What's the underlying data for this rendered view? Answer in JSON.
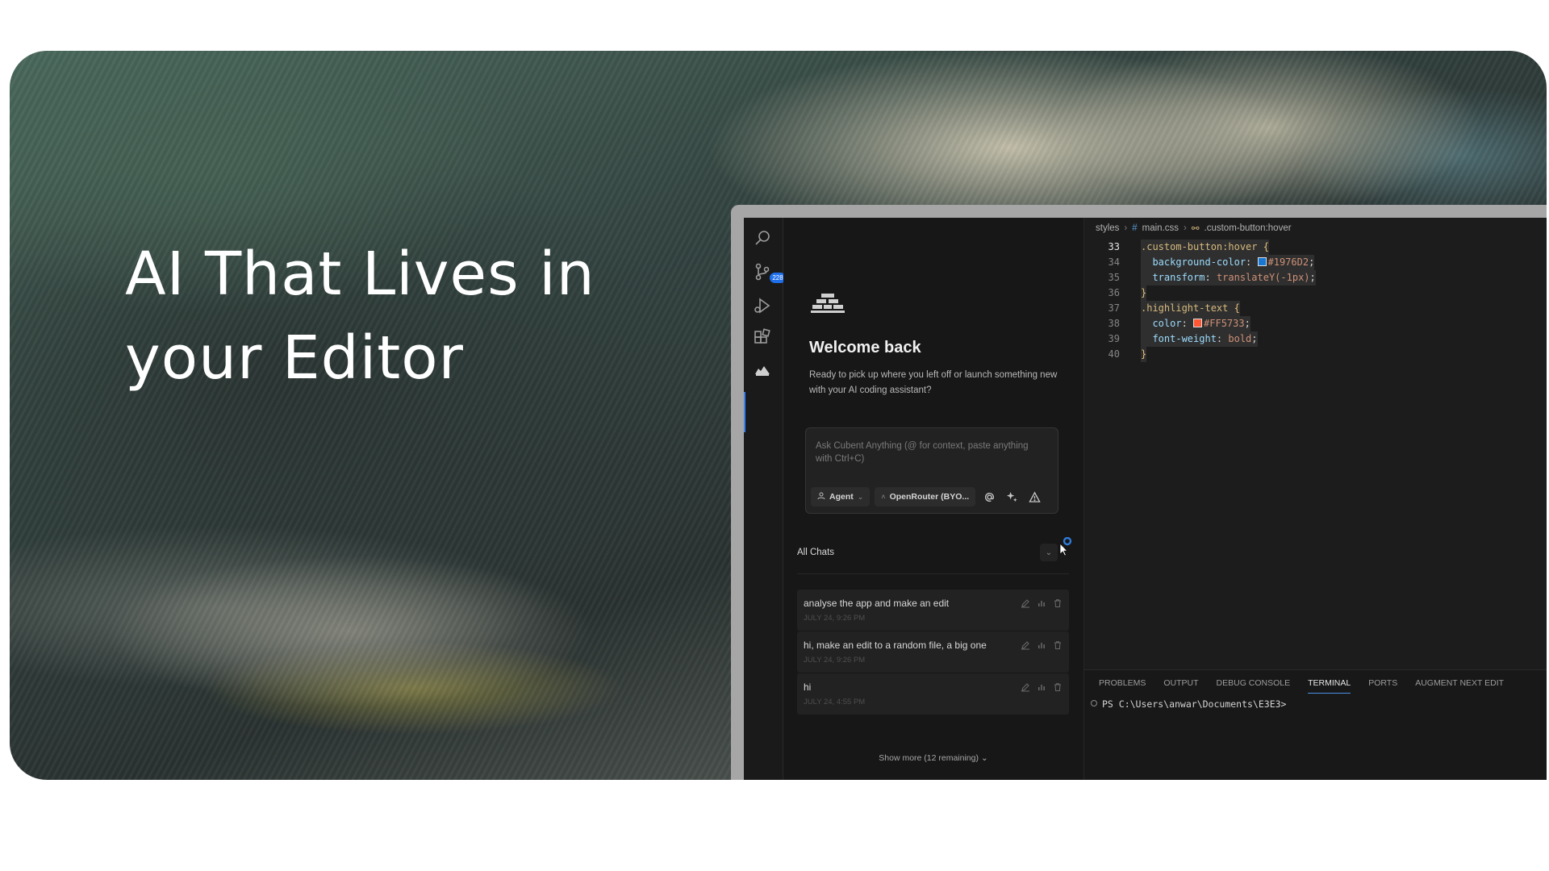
{
  "hero": {
    "headline_line1": "AI That Lives in",
    "headline_line2": "your Editor"
  },
  "activity_bar": {
    "icons": [
      "search-icon",
      "source-control-icon",
      "run-debug-icon",
      "extensions-icon",
      "cubent-icon"
    ],
    "source_control_badge": "228"
  },
  "chat_panel": {
    "welcome_title": "Welcome back",
    "welcome_subtitle": "Ready to pick up where you left off or launch something new with your AI coding assistant?",
    "input_placeholder": "Ask Cubent Anything (@ for context, paste anything with Ctrl+C)",
    "mode_label": "Agent",
    "model_label": "OpenRouter (BYO...",
    "all_chats_label": "All Chats",
    "chats": [
      {
        "title": "analyse the app and make an edit",
        "time": "JULY 24, 9:26 PM"
      },
      {
        "title": "hi, make an edit to a random file, a big one",
        "time": "JULY 24, 9:26 PM"
      },
      {
        "title": "hi",
        "time": "JULY 24, 4:55 PM"
      }
    ],
    "show_more": "Show more (12 remaining)"
  },
  "editor": {
    "breadcrumb": [
      "styles",
      "main.css",
      ".custom-button:hover"
    ],
    "lines": [
      {
        "n": "33",
        "parts": [
          [
            ".custom-button:hover",
            "sel"
          ],
          [
            " {",
            "brace"
          ]
        ]
      },
      {
        "n": "34",
        "parts": [
          [
            "  background-color",
            "prop"
          ],
          [
            ": ",
            "punc"
          ],
          [
            "swatch:#1976D2",
            "swatch"
          ],
          [
            "#1976D2",
            "val"
          ],
          [
            ";",
            "punc"
          ]
        ]
      },
      {
        "n": "35",
        "parts": [
          [
            "  transform",
            "prop"
          ],
          [
            ": ",
            "punc"
          ],
          [
            "translateY(-1px)",
            "val"
          ],
          [
            ";",
            "punc"
          ]
        ]
      },
      {
        "n": "36",
        "parts": [
          [
            "}",
            "brace"
          ]
        ]
      },
      {
        "n": "37",
        "parts": [
          [
            ".highlight-text",
            "sel"
          ],
          [
            " {",
            "brace"
          ]
        ]
      },
      {
        "n": "38",
        "parts": [
          [
            "  color",
            "prop"
          ],
          [
            ": ",
            "punc"
          ],
          [
            "swatch:#FF5733",
            "swatch"
          ],
          [
            "#FF5733",
            "val"
          ],
          [
            ";",
            "punc"
          ]
        ]
      },
      {
        "n": "39",
        "parts": [
          [
            "  font-weight",
            "prop"
          ],
          [
            ": ",
            "punc"
          ],
          [
            "bold",
            "val"
          ],
          [
            ";",
            "punc"
          ]
        ]
      },
      {
        "n": "40",
        "parts": [
          [
            "}",
            "brace"
          ]
        ]
      }
    ]
  },
  "panel": {
    "tabs": [
      "PROBLEMS",
      "OUTPUT",
      "DEBUG CONSOLE",
      "TERMINAL",
      "PORTS",
      "AUGMENT NEXT EDIT"
    ],
    "active_tab": "TERMINAL",
    "terminal_prompt": "PS C:\\Users\\anwar\\Documents\\E3E3>"
  },
  "colors": {
    "accent": "#3b82f6",
    "swatch_blue": "#1976D2",
    "swatch_orange": "#FF5733"
  }
}
